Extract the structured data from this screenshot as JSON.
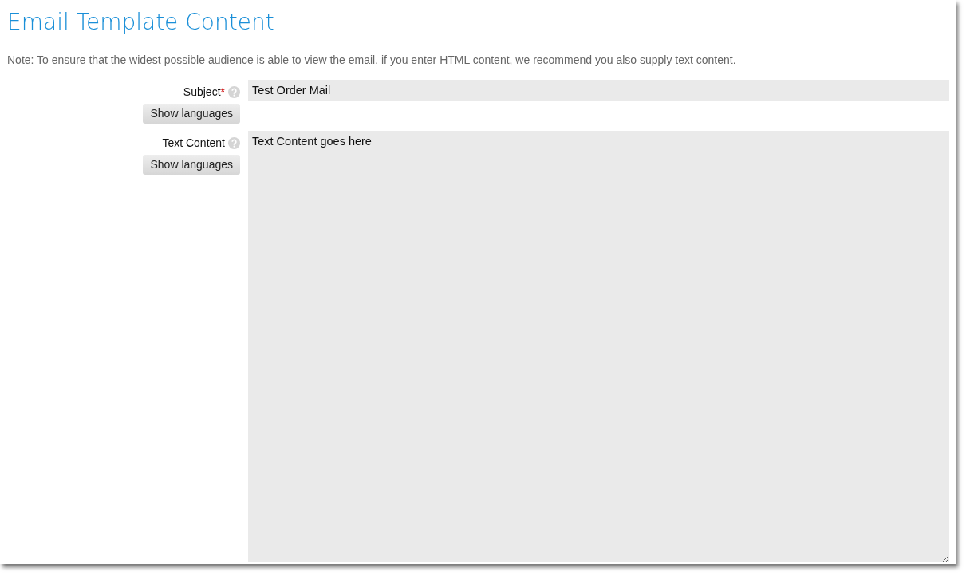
{
  "title": "Email Template Content",
  "note": "Note: To ensure that the widest possible audience is able to view the email, if you enter HTML content, we recommend you also supply text content.",
  "fields": [
    {
      "kind": "input",
      "label": "Subject",
      "required_mark": "*",
      "value": "Test Order Mail",
      "button": "Show languages"
    },
    {
      "kind": "textarea",
      "label": "Text Content",
      "value": "Text Content goes here",
      "button": "Show languages"
    }
  ]
}
